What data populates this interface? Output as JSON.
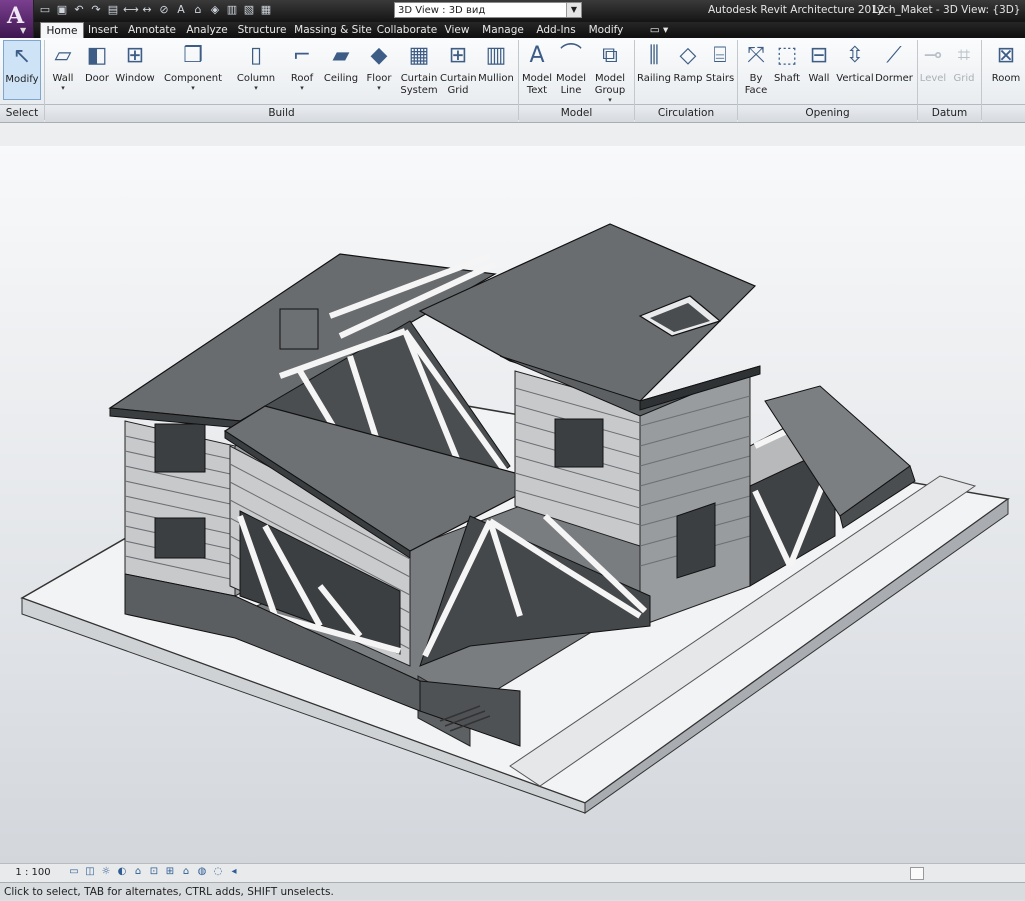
{
  "app": {
    "logo_glyph": "A",
    "title": "Autodesk Revit Architecture 2012 -",
    "document": "Lych_Maket - 3D View: {3D}"
  },
  "view_selector": {
    "value": "3D View : 3D вид"
  },
  "tabs": [
    {
      "label": "Home",
      "active": true
    },
    {
      "label": "Insert"
    },
    {
      "label": "Annotate"
    },
    {
      "label": "Analyze"
    },
    {
      "label": "Structure"
    },
    {
      "label": "Massing & Site"
    },
    {
      "label": "Collaborate"
    },
    {
      "label": "View"
    },
    {
      "label": "Manage"
    },
    {
      "label": "Add-Ins"
    },
    {
      "label": "Modify"
    }
  ],
  "ribbon": {
    "buttons": [
      {
        "label": "Modify",
        "icon": "cursor-icon"
      },
      {
        "label": "Wall",
        "icon": "wall-icon",
        "dropdown": true
      },
      {
        "label": "Door",
        "icon": "door-icon"
      },
      {
        "label": "Window",
        "icon": "window-icon"
      },
      {
        "label": "Component",
        "icon": "component-icon",
        "dropdown": true
      },
      {
        "label": "Column",
        "icon": "column-icon",
        "dropdown": true
      },
      {
        "label": "Roof",
        "icon": "roof-icon",
        "dropdown": true
      },
      {
        "label": "Ceiling",
        "icon": "ceiling-icon"
      },
      {
        "label": "Floor",
        "icon": "floor-icon",
        "dropdown": true
      },
      {
        "label": "Curtain System",
        "icon": "curtain-system-icon"
      },
      {
        "label": "Curtain Grid",
        "icon": "curtain-grid-icon"
      },
      {
        "label": "Mullion",
        "icon": "mullion-icon"
      },
      {
        "label": "Model Text",
        "icon": "model-text-icon"
      },
      {
        "label": "Model Line",
        "icon": "model-line-icon"
      },
      {
        "label": "Model Group",
        "icon": "model-group-icon",
        "dropdown": true
      },
      {
        "label": "Railing",
        "icon": "railing-icon"
      },
      {
        "label": "Ramp",
        "icon": "ramp-icon"
      },
      {
        "label": "Stairs",
        "icon": "stairs-icon"
      },
      {
        "label": "By Face",
        "icon": "by-face-icon"
      },
      {
        "label": "Shaft",
        "icon": "shaft-icon"
      },
      {
        "label": "Wall",
        "icon": "wall-opening-icon"
      },
      {
        "label": "Vertical",
        "icon": "vertical-opening-icon"
      },
      {
        "label": "Dormer",
        "icon": "dormer-icon"
      },
      {
        "label": "Level",
        "icon": "level-icon",
        "disabled": true
      },
      {
        "label": "Grid",
        "icon": "grid-icon",
        "disabled": true
      },
      {
        "label": "Room",
        "icon": "room-icon"
      }
    ],
    "panels": [
      {
        "label": "Select"
      },
      {
        "label": "Build"
      },
      {
        "label": "Model"
      },
      {
        "label": "Circulation"
      },
      {
        "label": "Opening"
      },
      {
        "label": "Datum"
      }
    ]
  },
  "view_control": {
    "scale": "1 : 100"
  },
  "status_bar": {
    "text": "Click to select, TAB for alternates, CTRL adds, SHIFT unselects."
  }
}
